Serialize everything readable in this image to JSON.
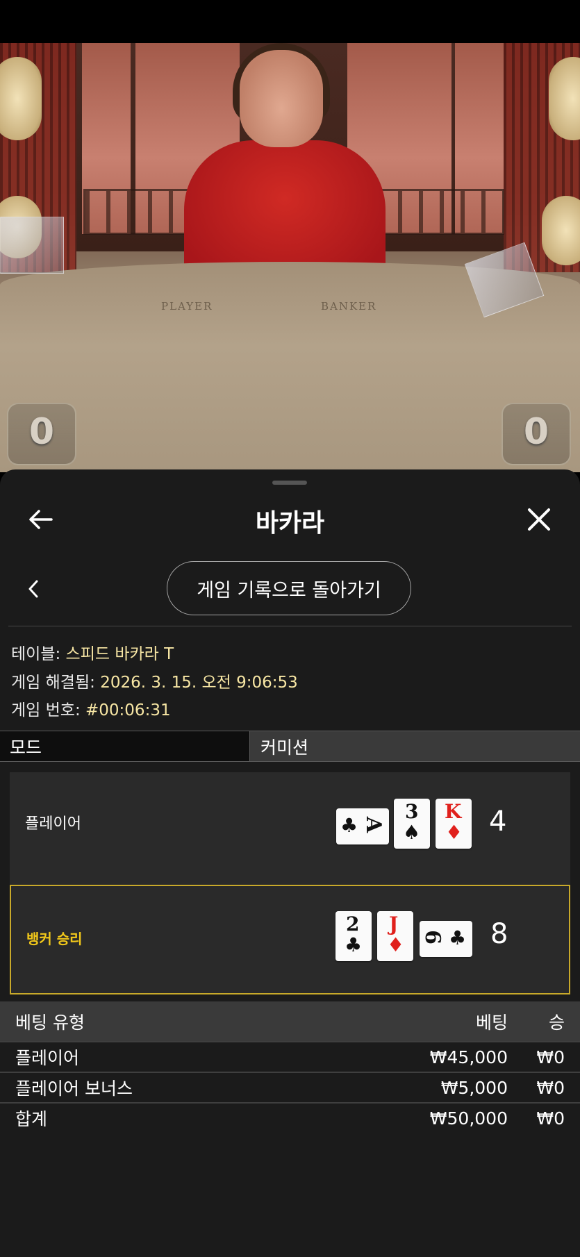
{
  "video": {
    "table_labels": [
      "PLAYER",
      "BANKER"
    ],
    "player_score": "0",
    "banker_score": "0"
  },
  "sheet": {
    "title": "바카라",
    "back_to_history": "게임 기록으로 돌아가기",
    "info": {
      "table_label": "테이블:",
      "table_value": "스피드 바카라 T",
      "resolved_label": "게임 해결됨:",
      "resolved_value": "2026. 3. 15. 오전 9:06:53",
      "game_no_label": "게임 번호:",
      "game_no_value": "#00:06:31"
    },
    "tabs": [
      "모드",
      "커미션"
    ],
    "hands": [
      {
        "label": "플레이어",
        "total": "4",
        "winner": false,
        "cards": [
          {
            "rank": "A",
            "suit": "♣",
            "color": "black",
            "rotated": true
          },
          {
            "rank": "3",
            "suit": "♠",
            "color": "black",
            "rotated": false
          },
          {
            "rank": "K",
            "suit": "♦",
            "color": "red",
            "rotated": false
          }
        ]
      },
      {
        "label": "뱅커 승리",
        "total": "8",
        "winner": true,
        "cards": [
          {
            "rank": "2",
            "suit": "♣",
            "color": "black",
            "rotated": false
          },
          {
            "rank": "J",
            "suit": "♦",
            "color": "red",
            "rotated": false
          },
          {
            "rank": "6",
            "suit": "♣",
            "color": "black",
            "rotated": true
          }
        ]
      }
    ],
    "bets": {
      "headers": {
        "type": "베팅 유형",
        "bet": "베팅",
        "win": "승"
      },
      "rows": [
        {
          "type": "플레이어",
          "bet": "₩45,000",
          "win": "₩0"
        },
        {
          "type": "플레이어 보너스",
          "bet": "₩5,000",
          "win": "₩0"
        },
        {
          "type": "합계",
          "bet": "₩50,000",
          "win": "₩0"
        }
      ]
    }
  },
  "colors": {
    "sheet_bg": "#1b1b1b",
    "accent_gold": "#c8a92a",
    "winner_text": "#f2c81a",
    "info_value": "#f7e6a4"
  },
  "icons": [
    "arrow-left-icon",
    "close-icon",
    "chevron-left-icon"
  ]
}
